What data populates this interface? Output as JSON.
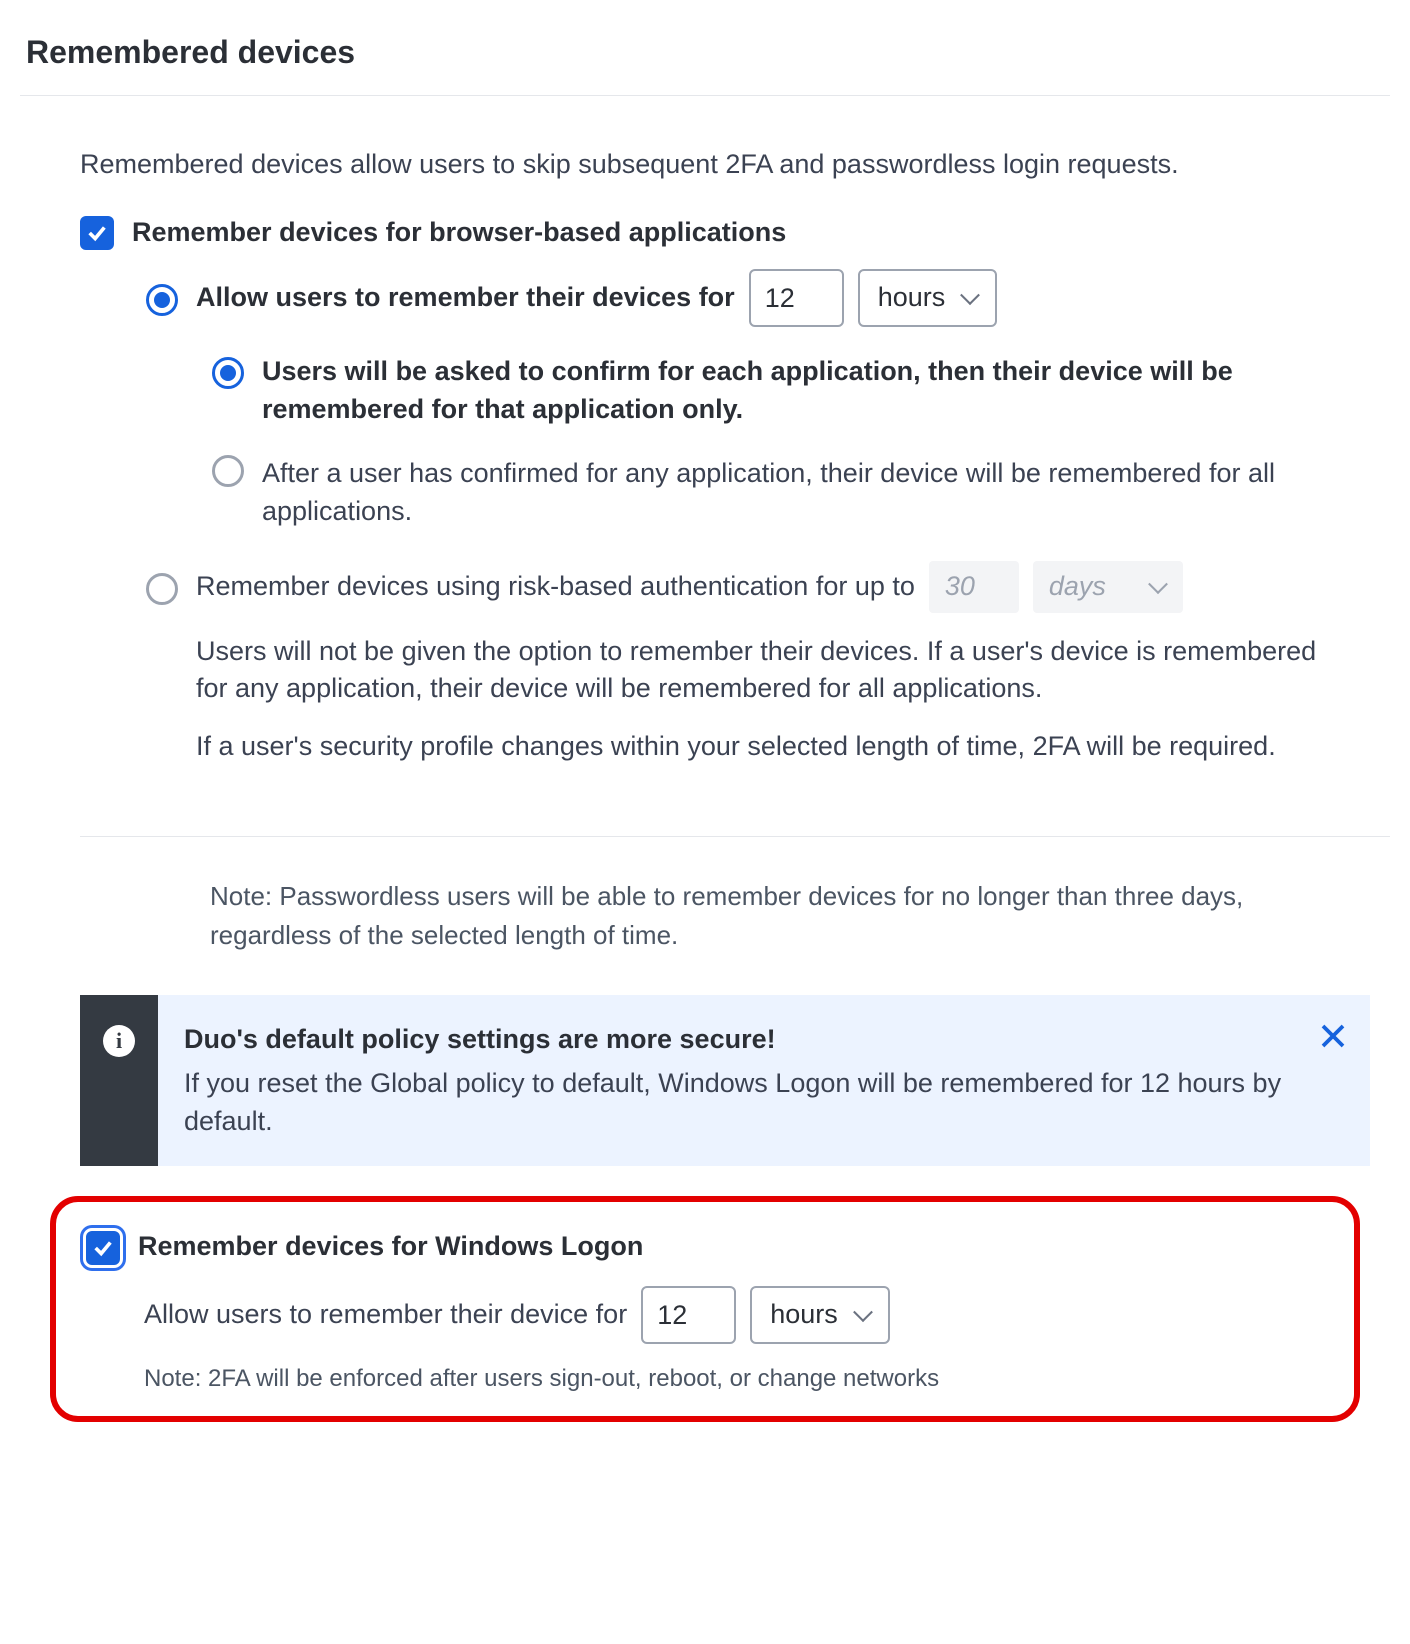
{
  "section_title": "Remembered devices",
  "intro": "Remembered devices allow users to skip subsequent 2FA and passwordless login requests.",
  "browser": {
    "checkbox_label": "Remember devices for browser-based applications",
    "allow": {
      "label": "Allow users to remember their devices for",
      "value": "12",
      "unit": "hours"
    },
    "sub_confirm": "Users will be asked to confirm for each application, then their device will be remembered for that application only.",
    "sub_all": "After a user has confirmed for any application, their device will be remembered for all applications.",
    "risk": {
      "label": "Remember devices using risk-based authentication for up to",
      "value": "30",
      "unit": "days",
      "para1": "Users will not be given the option to remember their devices. If a user's device is remembered for any application, their device will be remembered for all applications.",
      "para2": "If a user's security profile changes within your selected length of time, 2FA will be required."
    }
  },
  "note_passwordless": "Note: Passwordless users will be able to remember devices for no longer than three days, regardless of the selected length of time.",
  "banner": {
    "title": "Duo's default policy settings are more secure!",
    "body": "If you reset the Global policy to default, Windows Logon will be remembered for 12 hours by default."
  },
  "windows": {
    "checkbox_label": "Remember devices for Windows Logon",
    "allow_label": "Allow users to remember their device for",
    "value": "12",
    "unit": "hours",
    "note": "Note: 2FA will be enforced after users sign-out, reboot, or change networks"
  }
}
